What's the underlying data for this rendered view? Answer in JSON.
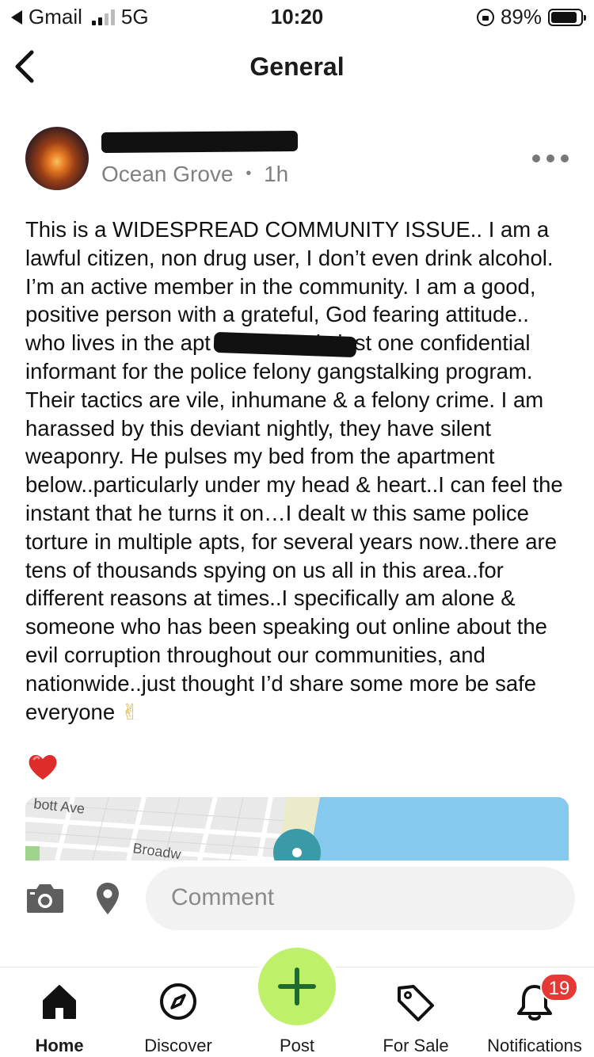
{
  "status_bar": {
    "back_app": "Gmail",
    "network": "5G",
    "time": "10:20",
    "battery": "89%",
    "battery_level": 0.89
  },
  "header": {
    "title": "General"
  },
  "post": {
    "location": "Ocean Grove",
    "separator": "•",
    "age": "1h",
    "body": "This is a WIDESPREAD COMMUNITY ISSUE.. I am a lawful citizen, non drug user, I don’t even drink alcohol. I’m an active member in the community. I am a good, positive person with a grateful, God fearing attitude..            who lives in the apt below me is just one confidential informant for the police felony gangstalking program. Their tactics are vile, inhumane & a felony crime. I am harassed by this deviant nightly, they have silent weaponry. He pulses my bed from the apartment below..particularly under my head & heart..I can feel the instant that he turns it on…I dealt w this same police torture in multiple apts, for several years now..there are tens of thousands spying on us all in this area..for different reasons at times..I specifically am alone & someone who has been speaking out online about the evil corruption throughout our communities, and nationwide..just thought I’d share some more be safe everyone ",
    "emoji_peace": "✌",
    "emoji_heart_icon": "heart-icon"
  },
  "map": {
    "street_1": "bott Ave",
    "street_2": "Broadw"
  },
  "comment_bar": {
    "placeholder": "Comment"
  },
  "tabs": [
    {
      "label": "Home",
      "icon": "home-icon"
    },
    {
      "label": "Discover",
      "icon": "compass-icon"
    },
    {
      "label": "Post",
      "icon": "plus-icon"
    },
    {
      "label": "For Sale",
      "icon": "tag-icon"
    },
    {
      "label": "Notifications",
      "icon": "bell-icon"
    }
  ],
  "notifications_badge": "19",
  "colors": {
    "post_button": "#bff06a",
    "badge": "#e53935",
    "water": "#86c9ee",
    "map_pin": "#3a9aa8"
  }
}
